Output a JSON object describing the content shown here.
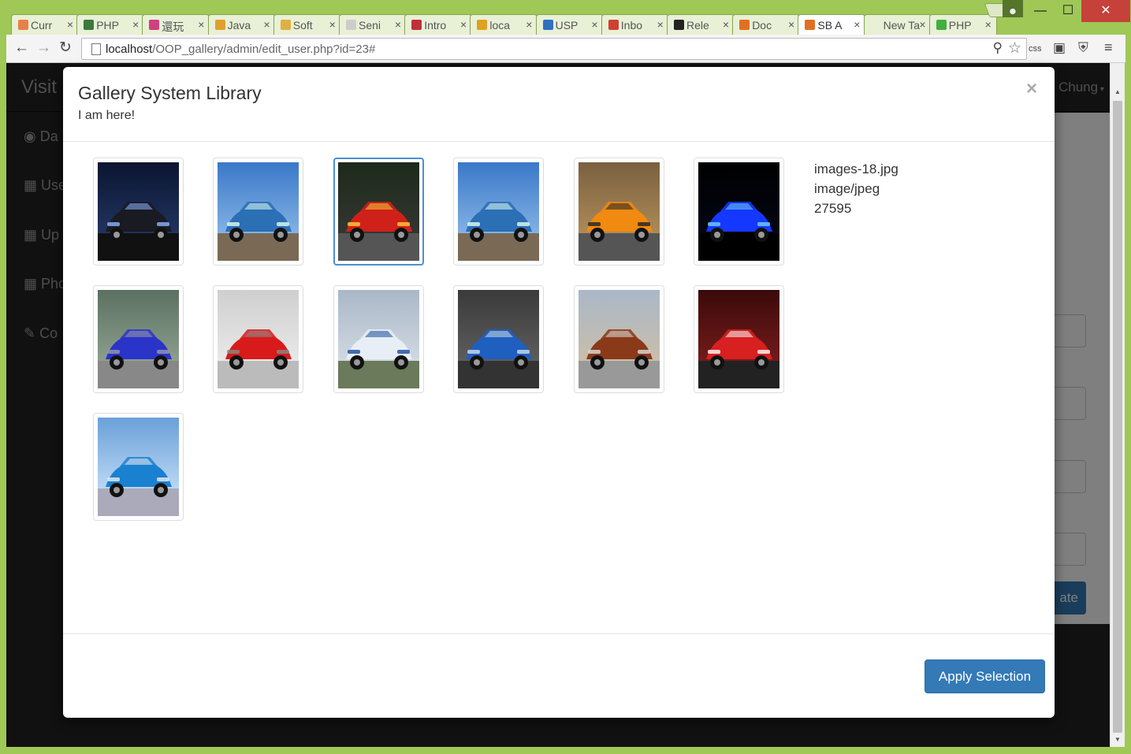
{
  "browser": {
    "tabs": [
      {
        "label": "Curr",
        "fav": "#e8804a"
      },
      {
        "label": "PHP",
        "fav": "#3a7a3a"
      },
      {
        "label": "還玩",
        "fav": "#d04080"
      },
      {
        "label": "Java",
        "fav": "#e0a030"
      },
      {
        "label": "Soft",
        "fav": "#e0b040"
      },
      {
        "label": "Seni",
        "fav": "#cccccc"
      },
      {
        "label": "Intro",
        "fav": "#c0303a"
      },
      {
        "label": "loca",
        "fav": "#e0a020"
      },
      {
        "label": "USP",
        "fav": "#3070c0"
      },
      {
        "label": "Inbo",
        "fav": "#d04030"
      },
      {
        "label": "Rele",
        "fav": "#222222"
      },
      {
        "label": "Doc",
        "fav": "#e07020"
      },
      {
        "label": "SB A",
        "fav": "#e07020"
      },
      {
        "label": "New Ta",
        "fav": ""
      },
      {
        "label": "PHP",
        "fav": "#40b040"
      }
    ],
    "active_tab_index": 12,
    "url_host": "localhost",
    "url_path": "/OOP_gallery/admin/edit_user.php?id=23#",
    "ext_css": "css"
  },
  "page": {
    "brand": "Visit H",
    "user": "Chung",
    "sidebar": [
      "Da",
      "Use",
      "Up",
      "Pho",
      "Co"
    ],
    "update_btn": "ate"
  },
  "modal": {
    "title": "Gallery System Library",
    "subtitle": "I am here!",
    "close_label": "×",
    "info": {
      "filename": "images-18.jpg",
      "type": "image/jpeg",
      "size": "27595"
    },
    "thumbnails": [
      {
        "name": "dark-lamborghini-lightning",
        "selected": false
      },
      {
        "name": "blue-muscle-car",
        "selected": false
      },
      {
        "name": "red-racing-game-car",
        "selected": true
      },
      {
        "name": "blue-muscle-car-2",
        "selected": false
      },
      {
        "name": "orange-supercar",
        "selected": false
      },
      {
        "name": "neon-blue-concept-car",
        "selected": false
      },
      {
        "name": "blue-gullwing-supercar",
        "selected": false
      },
      {
        "name": "red-ferrari-458",
        "selected": false
      },
      {
        "name": "flying-car",
        "selected": false
      },
      {
        "name": "blue-convertible",
        "selected": false
      },
      {
        "name": "vintage-muscle-car",
        "selected": false
      },
      {
        "name": "red-concept-car",
        "selected": false
      },
      {
        "name": "blue-bmw-i8",
        "selected": false
      }
    ],
    "apply_label": "Apply Selection"
  }
}
